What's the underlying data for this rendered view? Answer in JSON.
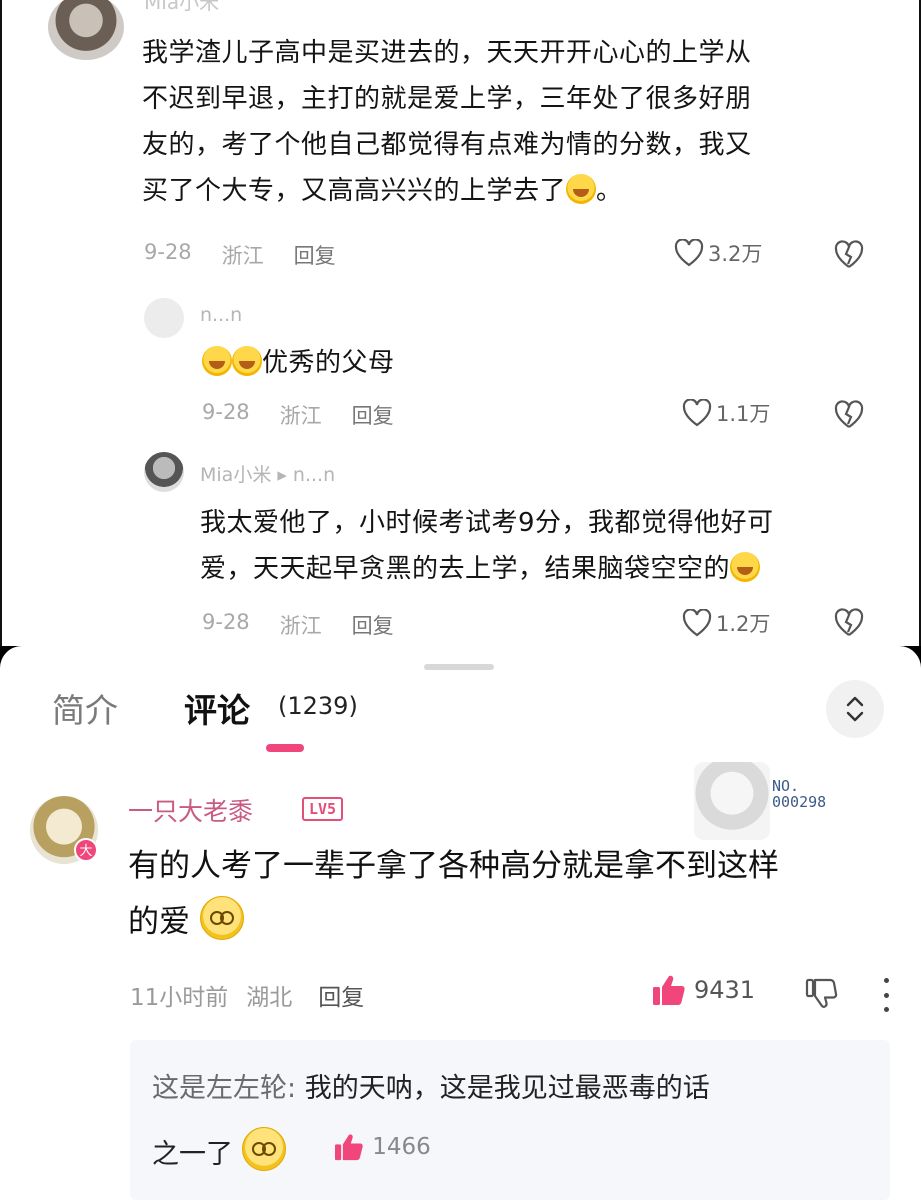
{
  "embedded_screenshot": {
    "main_comment": {
      "username": "Mia小米",
      "lines": [
        "我学渣儿子高中是买进去的，天天开开心心的上学从",
        "不迟到早退，主打的就是爱上学，三年处了很多好朋",
        "友的，考了个他自己都觉得有点难为情的分数，我又",
        "买了个大专，又高高兴兴的上学去了"
      ],
      "line_end": "。",
      "date": "9-28",
      "location": "浙江",
      "reply_label": "回复",
      "likes": "3.2万"
    },
    "reply_1": {
      "username": "n...n",
      "text": "优秀的父母",
      "date": "9-28",
      "location": "浙江",
      "reply_label": "回复",
      "likes": "1.1万"
    },
    "reply_2": {
      "username": "Mia小米 ▸ n...n",
      "lines": [
        "我太爱他了，小时候考试考9分，我都觉得他好可",
        "爱，天天起早贪黑的去上学，结果脑袋空空的"
      ],
      "date": "9-28",
      "location": "浙江",
      "reply_label": "回复",
      "likes": "1.2万"
    }
  },
  "panel": {
    "tab_intro": "简介",
    "tab_comments": "评论",
    "comment_count": "(1239)",
    "sort_icon": "chevron-up-down-icon",
    "accent_color": "#f0467b"
  },
  "comment": {
    "username": "一只大老黍",
    "level": "LV5",
    "pendant_no_label": "NO.",
    "pendant_no_value": "000298",
    "text_line1": "有的人考了一辈子拿了各种高分就是拿不到这样",
    "text_line2": "的爱",
    "time": "11小时前",
    "location": "湖北",
    "reply_label": "回复",
    "likes": "9431",
    "reply": {
      "author": "这是左左轮:",
      "text_line1": " 我的天呐，这是我见过最恶毒的话",
      "text_line2": "之一了",
      "likes": "1466"
    }
  }
}
